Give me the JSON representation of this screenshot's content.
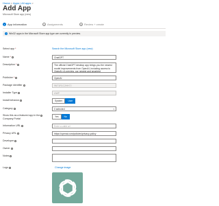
{
  "breadcrumbs": [
    "Home",
    "Apps | All apps"
  ],
  "header": {
    "title": "Add App",
    "subtitle": "Microsoft Store app (new)"
  },
  "tabs": [
    {
      "num": "1",
      "label": "App information",
      "active": true
    },
    {
      "num": "2",
      "label": "Assignments",
      "active": false
    },
    {
      "num": "3",
      "label": "Review + create",
      "active": false
    }
  ],
  "banner": {
    "text": "Win32 apps in the Microsoft Store app type are currently in preview."
  },
  "form": {
    "select_app": {
      "label": "Select app",
      "link": "Search the Microsoft Store app (new)"
    },
    "name": {
      "label": "Name",
      "value": "ChatGPT"
    },
    "description": {
      "label": "Description",
      "value": "The official ChatGPT desktop app brings you the newest model improvements from OpenAI, including access to OpenAI o1-preview, our newest and smartest"
    },
    "publisher": {
      "label": "Publisher",
      "value": "OpenAI"
    },
    "package_identifier": {
      "label": "Package identifier",
      "value": "9NT1R1C2HH7J"
    },
    "installer_type": {
      "label": "Installer Type",
      "value": "UWP"
    },
    "install_behavior": {
      "label": "Install behavior",
      "options": [
        "System",
        "User"
      ],
      "selected": "User"
    },
    "category": {
      "label": "Category",
      "value": "0 selected"
    },
    "featured": {
      "label_line1": "Show this as a featured app in the",
      "label_line2": "Company Portal",
      "options": [
        "Yes",
        "No"
      ],
      "selected": "No"
    },
    "information_url": {
      "label": "Information URL",
      "placeholder": "Enter a valid url"
    },
    "privacy_url": {
      "label": "Privacy URL",
      "value": "https://openai.com/policies/privacy-policy"
    },
    "developer": {
      "label": "Developer",
      "value": ""
    },
    "owner": {
      "label": "Owner",
      "value": ""
    },
    "notes": {
      "label": "Notes",
      "value": ""
    },
    "logo": {
      "label": "Logo",
      "link": "Change image"
    }
  },
  "colors": {
    "accent": "#0078d4",
    "logo_bg": "#74aa9c"
  }
}
